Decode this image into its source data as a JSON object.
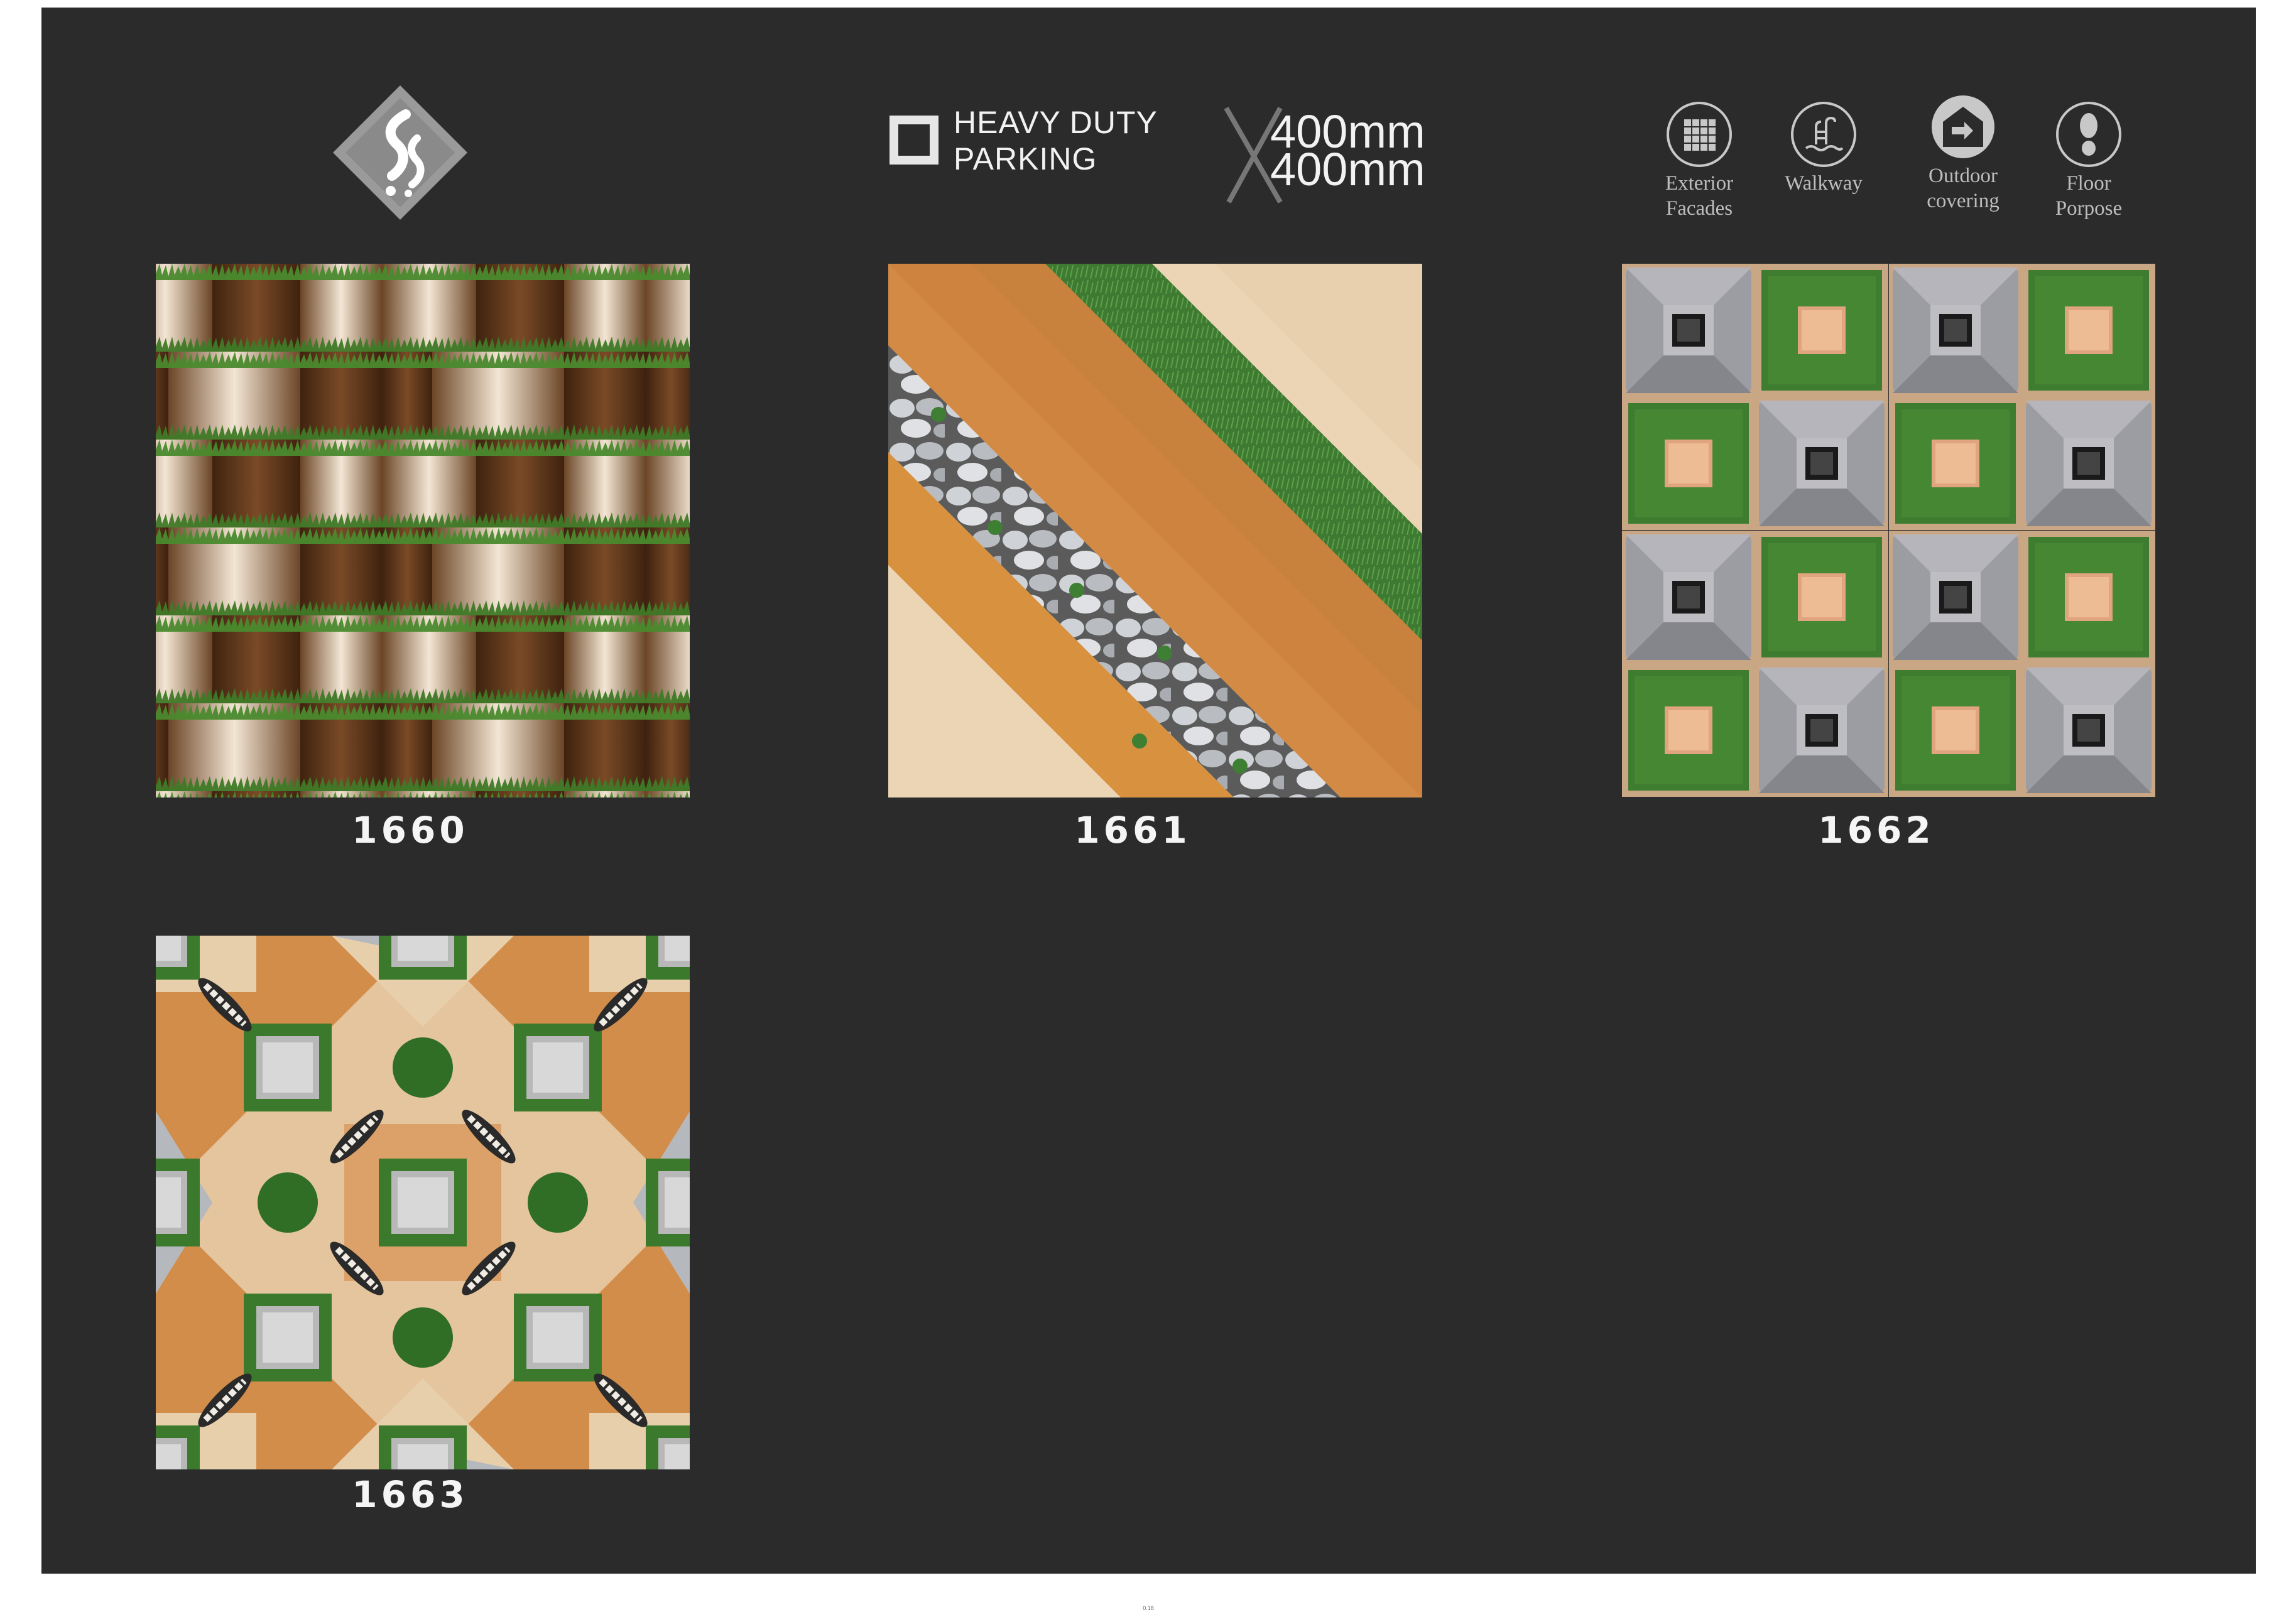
{
  "header": {
    "logo_name": "brand-logo",
    "spec_line1": "HEAVY DUTY",
    "spec_line2": "PARKING",
    "size_line1": "400mm",
    "size_line2": "400mm"
  },
  "usage": [
    {
      "line1": "Exterior",
      "line2": "Facades",
      "icon": "grid-tile-icon"
    },
    {
      "line1": "Walkway",
      "line2": "",
      "icon": "pool-ladder-icon"
    },
    {
      "line1": "Outdoor",
      "line2": "covering",
      "icon": "outdoor-house-icon"
    },
    {
      "line1": "Floor",
      "line2": "Porpose",
      "icon": "footprint-icon"
    }
  ],
  "tiles": [
    {
      "code": "1660",
      "pattern": "wood-grass-weave"
    },
    {
      "code": "1661",
      "pattern": "diagonal-wood-grass-pebbles"
    },
    {
      "code": "1662",
      "pattern": "grey-cushion-grass-checker"
    },
    {
      "code": "1663",
      "pattern": "wood-rope-grass-star"
    }
  ],
  "page_number": "0.18",
  "colors": {
    "panel": "#2b2b2b",
    "text": "#f2f2f2",
    "grass": "#3c7a2c",
    "wood_dark": "#5a3419",
    "wood_light": "#d8b28a",
    "stone_grey": "#9c9ca3"
  }
}
